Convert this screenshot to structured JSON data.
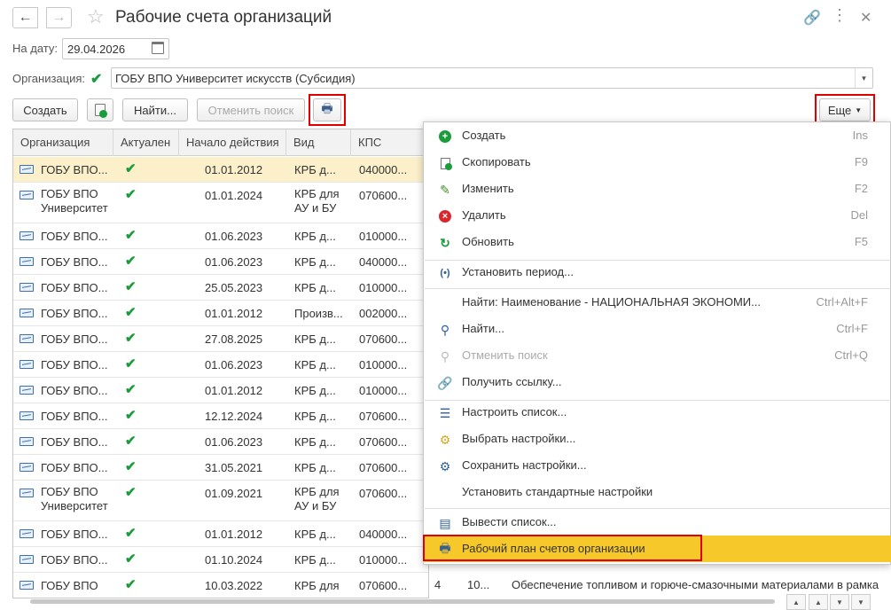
{
  "window": {
    "title": "Рабочие счета организаций"
  },
  "filters": {
    "date_label": "На дату:",
    "date_value": "29.04.2026",
    "org_label": "Организация:",
    "org_value": "ГОБУ ВПО Университет искусств (Субсидия)"
  },
  "toolbar": {
    "create": "Создать",
    "find": "Найти...",
    "cancel_search": "Отменить поиск",
    "more": "Еще"
  },
  "table": {
    "columns": [
      "Организация",
      "Актуален",
      "Начало действия",
      "Вид",
      "КПС"
    ],
    "rows": [
      {
        "org": "ГОБУ ВПО...",
        "date": "01.01.2012",
        "kind": "КРБ д...",
        "kps": "040000..."
      },
      {
        "org": "ГОБУ ВПО Университет",
        "date": "01.01.2024",
        "kind": "КРБ для АУ и БУ",
        "kps": "070600..."
      },
      {
        "org": "ГОБУ ВПО...",
        "date": "01.06.2023",
        "kind": "КРБ д...",
        "kps": "010000..."
      },
      {
        "org": "ГОБУ ВПО...",
        "date": "01.06.2023",
        "kind": "КРБ д...",
        "kps": "040000..."
      },
      {
        "org": "ГОБУ ВПО...",
        "date": "25.05.2023",
        "kind": "КРБ д...",
        "kps": "010000..."
      },
      {
        "org": "ГОБУ ВПО...",
        "date": "01.01.2012",
        "kind": "Произв...",
        "kps": "002000..."
      },
      {
        "org": "ГОБУ ВПО...",
        "date": "27.08.2025",
        "kind": "КРБ д...",
        "kps": "070600..."
      },
      {
        "org": "ГОБУ ВПО...",
        "date": "01.06.2023",
        "kind": "КРБ д...",
        "kps": "010000..."
      },
      {
        "org": "ГОБУ ВПО...",
        "date": "01.01.2012",
        "kind": "КРБ д...",
        "kps": "010000..."
      },
      {
        "org": "ГОБУ ВПО...",
        "date": "12.12.2024",
        "kind": "КРБ д...",
        "kps": "070600..."
      },
      {
        "org": "ГОБУ ВПО...",
        "date": "01.06.2023",
        "kind": "КРБ д...",
        "kps": "070600..."
      },
      {
        "org": "ГОБУ ВПО...",
        "date": "31.05.2021",
        "kind": "КРБ д...",
        "kps": "070600..."
      },
      {
        "org": "ГОБУ ВПО Университет",
        "date": "01.09.2021",
        "kind": "КРБ для АУ и БУ",
        "kps": "070600..."
      },
      {
        "org": "ГОБУ ВПО...",
        "date": "01.01.2012",
        "kind": "КРБ д...",
        "kps": "040000..."
      },
      {
        "org": "ГОБУ ВПО...",
        "date": "01.10.2024",
        "kind": "КРБ д...",
        "kps": "010000..."
      },
      {
        "org": "ГОБУ ВПО",
        "date": "10.03.2022",
        "kind": "КРБ для",
        "kps": "070600..."
      }
    ],
    "last_row_extra": {
      "c1": "4",
      "c2": "10...",
      "c3": "Обеспечение топливом и горюче-смазочными материалами в рамка"
    }
  },
  "menu": {
    "items": [
      {
        "label": "Создать",
        "shortcut": "Ins",
        "icon": "plus-circle-icon"
      },
      {
        "label": "Скопировать",
        "shortcut": "F9",
        "icon": "copy-icon"
      },
      {
        "label": "Изменить",
        "shortcut": "F2",
        "icon": "pencil-icon"
      },
      {
        "label": "Удалить",
        "shortcut": "Del",
        "icon": "delete-icon"
      },
      {
        "label": "Обновить",
        "shortcut": "F5",
        "icon": "refresh-icon"
      },
      {
        "label": "Установить период...",
        "shortcut": "",
        "icon": "period-icon"
      },
      {
        "label": "Найти: Наименование - НАЦИОНАЛЬНАЯ ЭКОНОМИ...",
        "shortcut": "Ctrl+Alt+F",
        "icon": ""
      },
      {
        "label": "Найти...",
        "shortcut": "Ctrl+F",
        "icon": "search-icon"
      },
      {
        "label": "Отменить поиск",
        "shortcut": "Ctrl+Q",
        "icon": "cancel-search-icon"
      },
      {
        "label": "Получить ссылку...",
        "shortcut": "",
        "icon": "link-icon"
      },
      {
        "label": "Настроить список...",
        "shortcut": "",
        "icon": "list-settings-icon"
      },
      {
        "label": "Выбрать настройки...",
        "shortcut": "",
        "icon": "folder-settings-icon"
      },
      {
        "label": "Сохранить настройки...",
        "shortcut": "",
        "icon": "save-settings-icon"
      },
      {
        "label": "Установить стандартные настройки",
        "shortcut": "",
        "icon": ""
      },
      {
        "label": "Вывести список...",
        "shortcut": "",
        "icon": "export-list-icon"
      },
      {
        "label": "Рабочий план счетов организации",
        "shortcut": "",
        "icon": "printer-icon"
      }
    ]
  },
  "colors": {
    "accent": "#f7c82a",
    "highlight_frame": "#e00000",
    "check": "#1a9c3c",
    "selected_row": "#fbf0c9"
  }
}
